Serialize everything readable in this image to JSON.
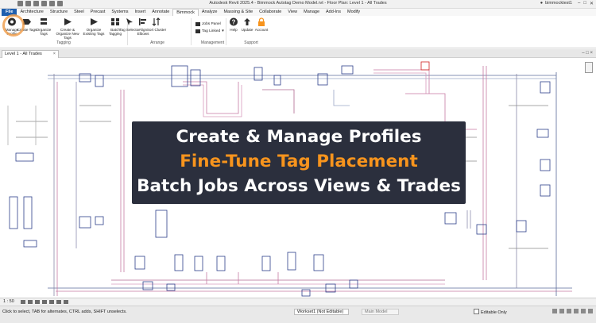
{
  "window": {
    "title": "Autodesk Revit 2025.4 - Bimmock Autotag Demo Model.rvt - Floor Plan: Level 1 - All Trades",
    "user": "bimmocktest1"
  },
  "ribbon_tabs": [
    "File",
    "Architecture",
    "Structure",
    "Steel",
    "Precast",
    "Systems",
    "Insert",
    "Annotate",
    "Bimmock",
    "Analyze",
    "Massing & Site",
    "Collaborate",
    "View",
    "Manage",
    "Add-Ins",
    "Modify"
  ],
  "active_tab": "Bimmock",
  "ribbon": {
    "buttons": {
      "manage_profile": "Manage Profile",
      "create_tags": "Create Tags",
      "organize_tags": "Organize Tags",
      "create_organize_new_tags": "Create & Organize New Tags",
      "organize_existing_tags": "Organize Existing Tags",
      "batch_tagging": "Batch Tagging",
      "tag_selector": "Tag Selector",
      "align_elbows": "Align Elbows",
      "sort_cluster": "Sort Cluster",
      "jobs_panel": "Jobs Panel",
      "tag_linked": "Tag Linked",
      "help": "Help",
      "update": "Update",
      "account": "Account"
    },
    "groups": {
      "tagging": "Tagging",
      "arrange": "Arrange",
      "management": "Management",
      "support": "Support"
    }
  },
  "view_tab": {
    "label": "Level 1 - All Trades"
  },
  "overlay": {
    "line1": "Create & Manage Profiles",
    "line2": "Fine-Tune Tag Placement",
    "line3": "Batch Jobs Across Views & Trades",
    "highlight_color": "#f7941d"
  },
  "view_control": {
    "scale": "1 : 50"
  },
  "status": {
    "hint": "Click to select, TAB for alternates, CTRL adds, SHIFT unselects.",
    "workset": "Workset1 (Not Editable)",
    "model": "Main Model",
    "editable_only": "Editable Only"
  },
  "colors": {
    "file_tab": "#1f5fae",
    "banner_bg": "#2b2f3d",
    "accent": "#f7941d"
  }
}
